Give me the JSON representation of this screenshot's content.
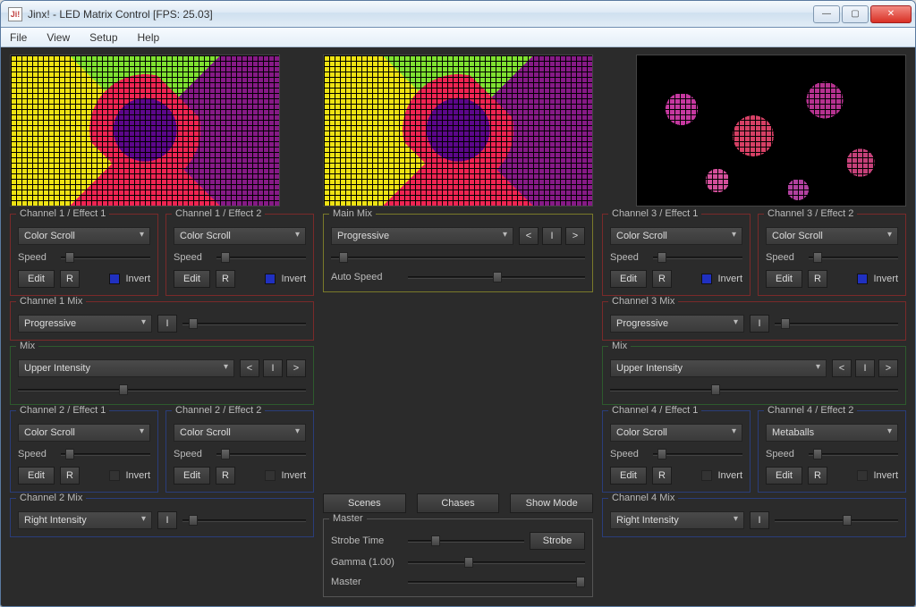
{
  "title": "Jinx! - LED Matrix Control [FPS: 25.03]",
  "appIconText": "Ji!",
  "menu": [
    "File",
    "View",
    "Setup",
    "Help"
  ],
  "winbtns": {
    "min": "—",
    "max": "▢",
    "close": "✕"
  },
  "panels": {
    "ch1e1": {
      "legend": "Channel 1 / Effect 1",
      "combo": "Color Scroll",
      "speed_lbl": "Speed",
      "edit": "Edit",
      "r": "R",
      "invert": "Invert",
      "swatch": "blue"
    },
    "ch1e2": {
      "legend": "Channel 1 / Effect 2",
      "combo": "Color Scroll",
      "speed_lbl": "Speed",
      "edit": "Edit",
      "r": "R",
      "invert": "Invert",
      "swatch": "blue"
    },
    "ch1mix": {
      "legend": "Channel 1 Mix",
      "combo": "Progressive",
      "btn_i": "I"
    },
    "mix1": {
      "legend": "Mix",
      "combo": "Upper Intensity",
      "prev": "<",
      "btn_i": "I",
      "next": ">"
    },
    "ch2e1": {
      "legend": "Channel 2 / Effect 1",
      "combo": "Color Scroll",
      "speed_lbl": "Speed",
      "edit": "Edit",
      "r": "R",
      "invert": "Invert",
      "swatch": "none"
    },
    "ch2e2": {
      "legend": "Channel 2 / Effect 2",
      "combo": "Color Scroll",
      "speed_lbl": "Speed",
      "edit": "Edit",
      "r": "R",
      "invert": "Invert",
      "swatch": "none"
    },
    "ch2mix": {
      "legend": "Channel 2 Mix",
      "combo": "Right Intensity",
      "btn_i": "I"
    },
    "ch3e1": {
      "legend": "Channel 3 / Effect 1",
      "combo": "Color Scroll",
      "speed_lbl": "Speed",
      "edit": "Edit",
      "r": "R",
      "invert": "Invert",
      "swatch": "blue"
    },
    "ch3e2": {
      "legend": "Channel 3 / Effect 2",
      "combo": "Color Scroll",
      "speed_lbl": "Speed",
      "edit": "Edit",
      "r": "R",
      "invert": "Invert",
      "swatch": "blue"
    },
    "ch3mix": {
      "legend": "Channel 3 Mix",
      "combo": "Progressive",
      "btn_i": "I"
    },
    "mix3": {
      "legend": "Mix",
      "combo": "Upper Intensity",
      "prev": "<",
      "btn_i": "I",
      "next": ">"
    },
    "ch4e1": {
      "legend": "Channel 4 / Effect 1",
      "combo": "Color Scroll",
      "speed_lbl": "Speed",
      "edit": "Edit",
      "r": "R",
      "invert": "Invert",
      "swatch": "none"
    },
    "ch4e2": {
      "legend": "Channel 4 / Effect 2",
      "combo": "Metaballs",
      "speed_lbl": "Speed",
      "edit": "Edit",
      "r": "R",
      "invert": "Invert",
      "swatch": "none"
    },
    "ch4mix": {
      "legend": "Channel 4 Mix",
      "combo": "Right Intensity",
      "btn_i": "I"
    },
    "mainmix": {
      "legend": "Main Mix",
      "combo": "Progressive",
      "prev": "<",
      "btn_i": "I",
      "next": ">",
      "autospeed": "Auto Speed"
    },
    "toolbar": {
      "scenes": "Scenes",
      "chases": "Chases",
      "showmode": "Show Mode"
    },
    "master": {
      "legend": "Master",
      "strobetime": "Strobe Time",
      "strobe": "Strobe",
      "gamma": "Gamma (1.00)",
      "master": "Master"
    }
  }
}
